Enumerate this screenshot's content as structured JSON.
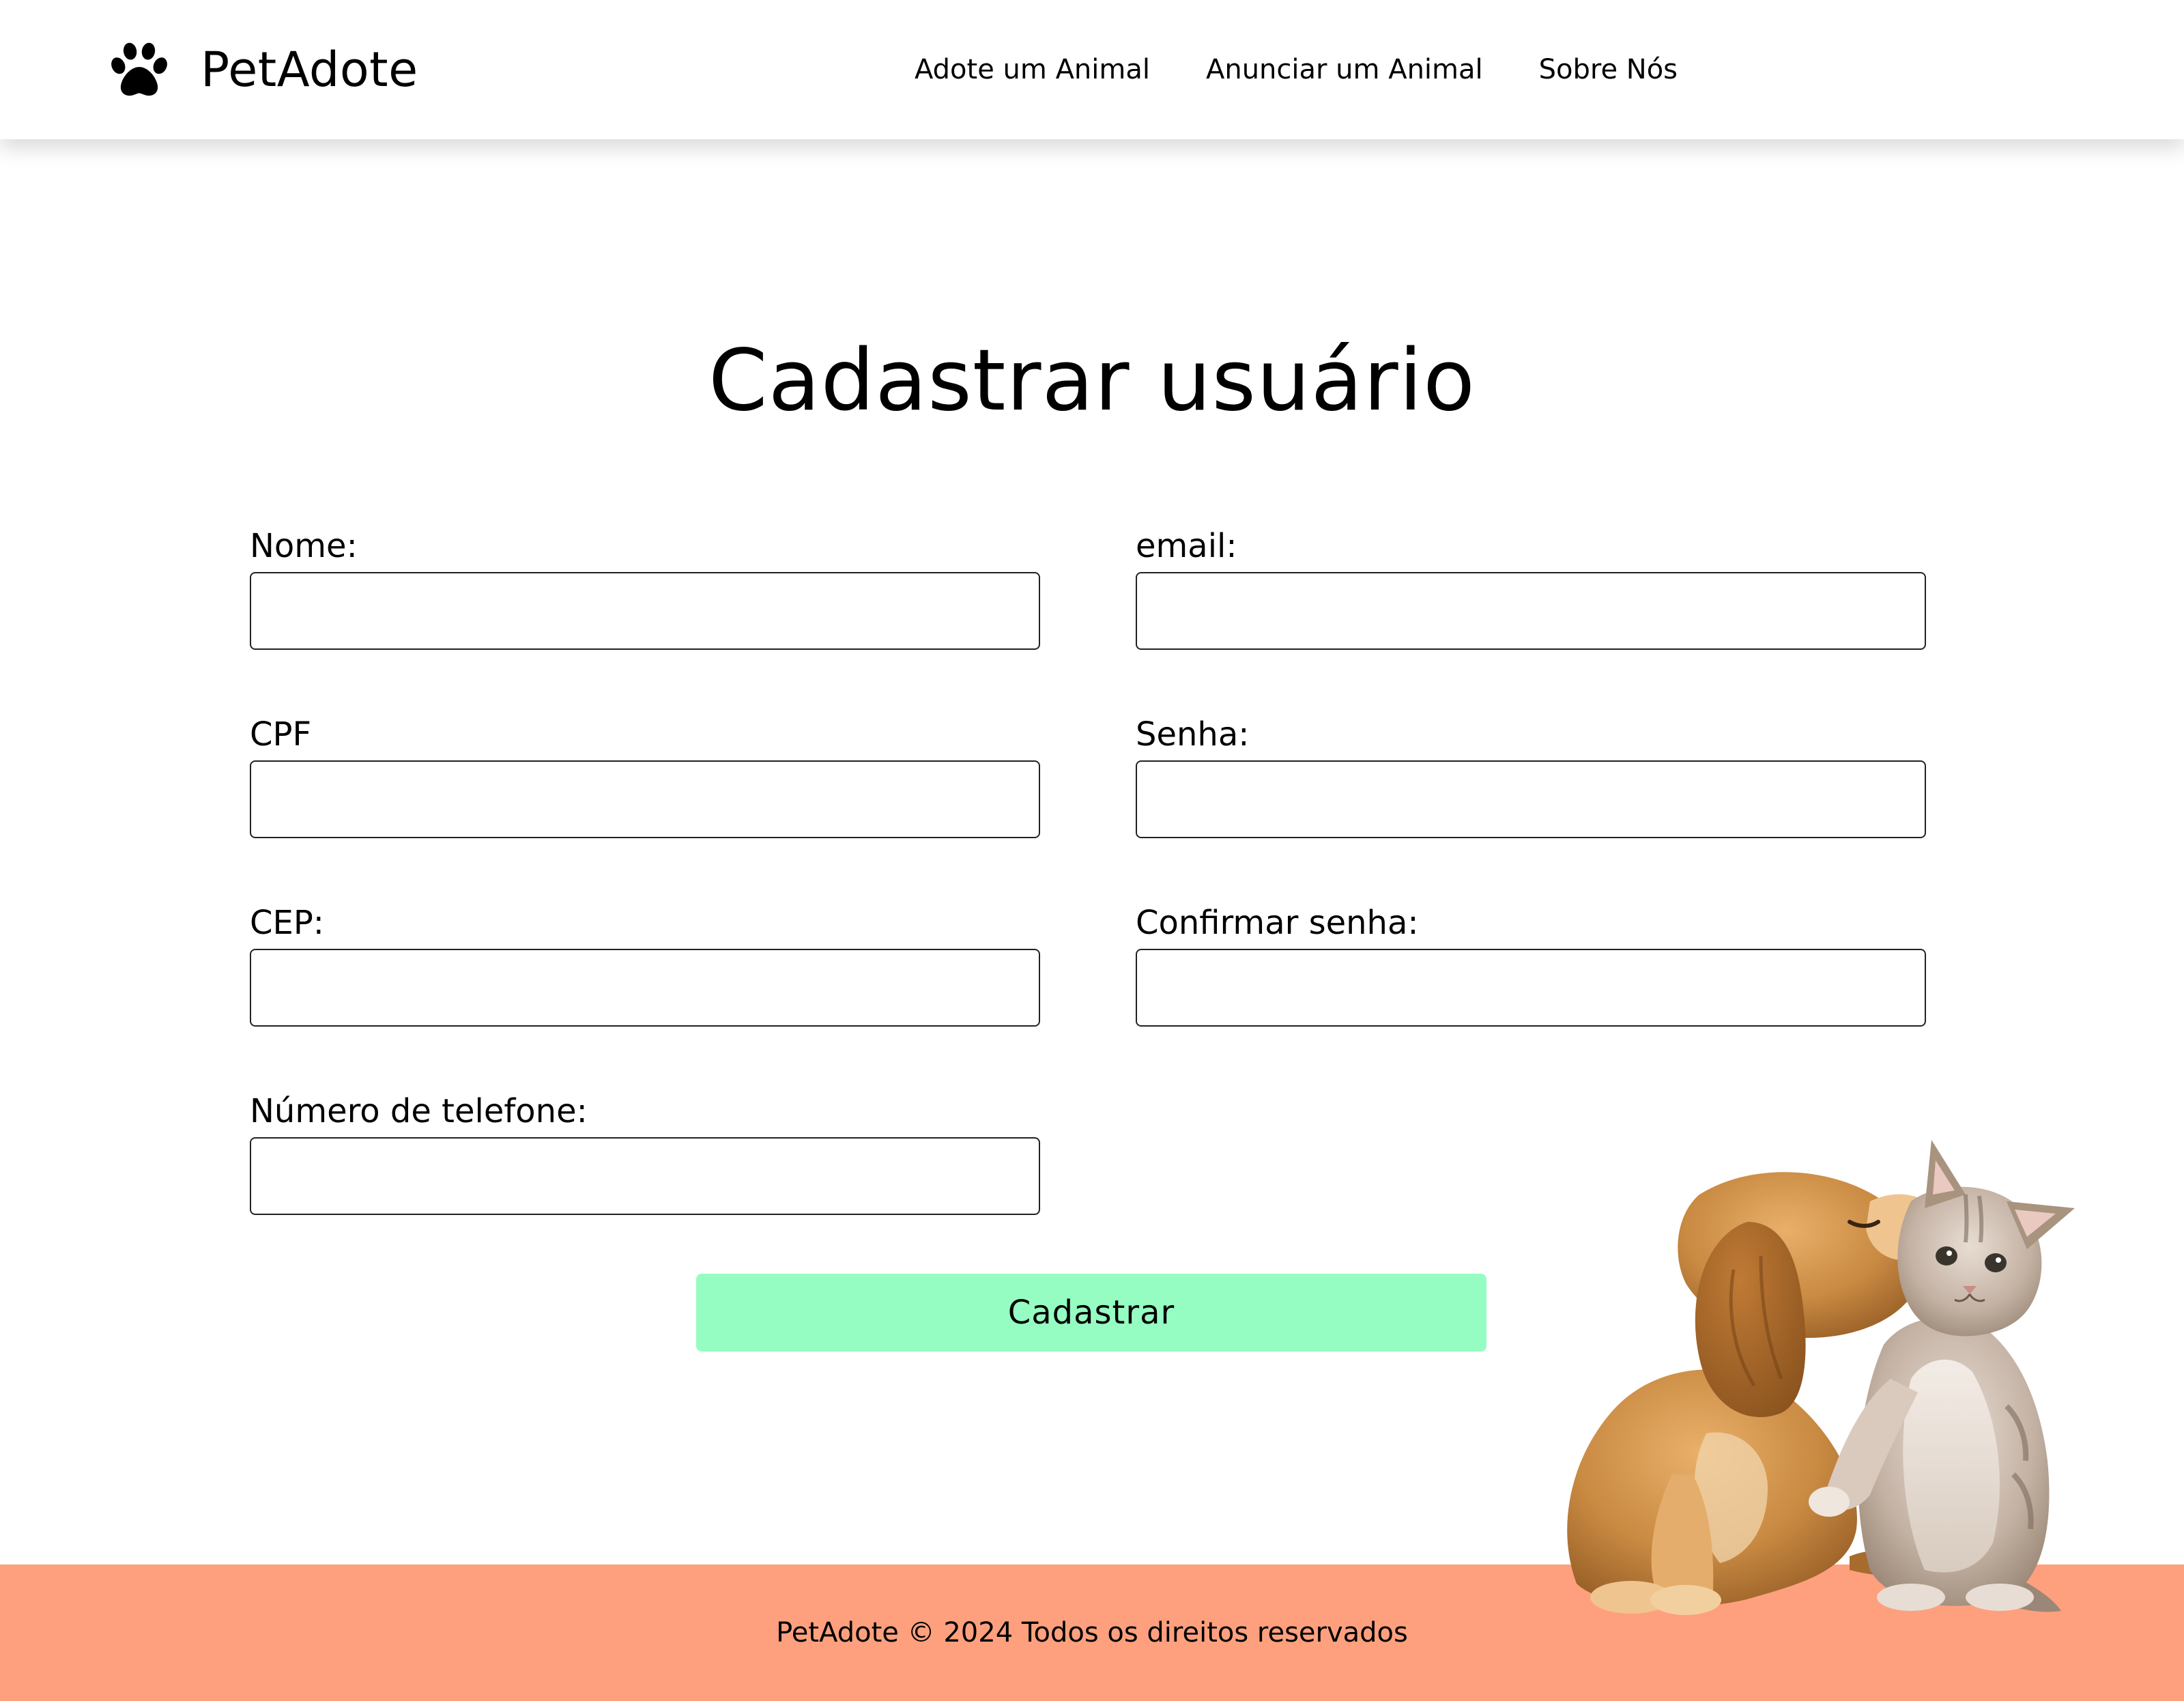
{
  "header": {
    "logo_icon": "paw-icon",
    "brand": "PetAdote",
    "nav": [
      {
        "label": "Adote um Animal"
      },
      {
        "label": "Anunciar um Animal"
      },
      {
        "label": "Sobre Nós"
      }
    ]
  },
  "main": {
    "title": "Cadastrar usuário",
    "form": {
      "nome": {
        "label": "Nome:",
        "value": ""
      },
      "cpf": {
        "label": "CPF",
        "value": ""
      },
      "cep": {
        "label": "CEP:",
        "value": ""
      },
      "telefone": {
        "label": "Número de telefone:",
        "value": ""
      },
      "email": {
        "label": "email:",
        "value": ""
      },
      "senha": {
        "label": "Senha:",
        "value": ""
      },
      "confirmar_senha": {
        "label": "Confirmar senha:",
        "value": ""
      },
      "submit_label": "Cadastrar"
    },
    "illustration": "puppy-and-kitten-image"
  },
  "footer": {
    "text": "PetAdote © 2024 Todos os direitos reservados"
  },
  "colors": {
    "button": "#96fdc2",
    "footer": "#fea07e",
    "text": "#000000"
  }
}
